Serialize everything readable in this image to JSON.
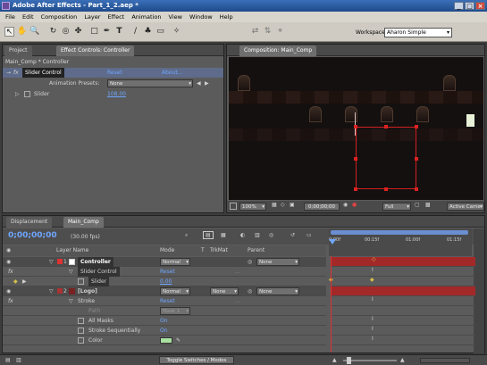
{
  "window": {
    "title": "Adobe After Effects - Part_1_2.aep *",
    "min": "_",
    "max": "□",
    "close": "×"
  },
  "menu": [
    "File",
    "Edit",
    "Composition",
    "Layer",
    "Effect",
    "Animation",
    "View",
    "Window",
    "Help"
  ],
  "toolbar": {
    "tools": [
      "arrow-icon",
      "hand-icon",
      "zoom-icon",
      "rotate-icon",
      "orbit-camera-icon",
      "pan-behind-icon",
      "mask-icon",
      "pen-icon",
      "text-icon",
      "brush-icon",
      "clone-stamp-icon",
      "eraser-icon",
      "puppet-pin-icon"
    ],
    "workspace_label": "Workspace:",
    "workspace_value": "Aharon Simple"
  },
  "project_panel": {
    "tabs": [
      "Project",
      "Effect Controls: Controller"
    ],
    "breadcrumb": "Main_Comp * Controller",
    "effect_name": "Slider Control",
    "reset": "Reset",
    "about": "About...",
    "presets_label": "Animation Presets:",
    "presets_value": "None",
    "slider_label": "Slider",
    "slider_value": "108.00"
  },
  "comp_panel": {
    "tab": "Composition: Main_Comp",
    "zoom": "100%",
    "timecode": "0;00;00;00",
    "resolution": "Full",
    "camera": "Active Came"
  },
  "timeline": {
    "tabs": [
      "Displacement",
      "Main_Comp"
    ],
    "timecode": "0;00;00;00",
    "fps": "(30.00 fps)",
    "headers": {
      "layer_name": "Layer Name",
      "mode": "Mode",
      "t": "T",
      "trkmat": "TrkMat",
      "parent": "Parent"
    },
    "ruler": [
      "0:00f",
      "00:15f",
      "01:00f",
      "01:15f"
    ],
    "rows": [
      {
        "num": "1",
        "name": "Controller",
        "mode": "Normal",
        "parent": "None"
      },
      {
        "prop": "Slider Control",
        "value": "Reset"
      },
      {
        "prop": "Slider",
        "value": "0.00"
      },
      {
        "num": "2",
        "name": "[Logo]",
        "mode": "Normal",
        "trkmat": "None",
        "parent": "None"
      },
      {
        "prop": "Stroke",
        "value": "Reset"
      },
      {
        "prop": "Path",
        "value": "Mask 1"
      },
      {
        "prop": "All Masks",
        "value": "On"
      },
      {
        "prop": "Stroke Sequentially",
        "value": "On"
      },
      {
        "prop": "Color",
        "value": ""
      }
    ],
    "toggle_label": "Toggle Switches / Modes"
  },
  "colors": {
    "accent": "#6fa6ff",
    "label_red": "#a32929",
    "keyframe": "#d6c04a"
  }
}
